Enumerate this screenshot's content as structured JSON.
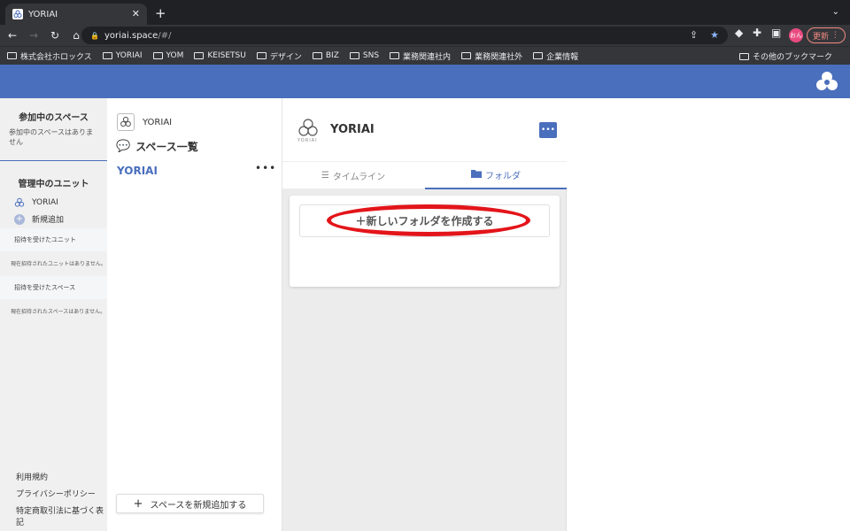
{
  "browser": {
    "tab_title": "YORIAI",
    "tab_close": "✕",
    "new_tab": "+",
    "url_host": "yoriai.space",
    "url_path": "/#/",
    "update_label": "更新",
    "profile_initials": "おん",
    "bookmarks": [
      "株式会社ホロックス",
      "YORIAI",
      "YOM",
      "KEISETSU",
      "デザイン",
      "BIZ",
      "SNS",
      "業務関連社内",
      "業務関連社外",
      "企業情報"
    ],
    "other_bookmarks": "その他のブックマーク"
  },
  "left_sidebar": {
    "joined_spaces_title": "参加中のスペース",
    "joined_spaces_empty": "参加中のスペースはありません",
    "managed_units_title": "管理中のユニット",
    "unit_name": "YORIAI",
    "add_new_label": "新規追加",
    "invited_units_label": "招待を受けたユニット",
    "invited_units_empty": "現在招待されたユニットはありません。",
    "invited_spaces_label": "招待を受けたスペース",
    "invited_spaces_empty": "現在招待されたスペースはありません。",
    "footer_links": [
      "利用規約",
      "プライバシーポリシー",
      "特定商取引法に基づく表記"
    ]
  },
  "middle_panel": {
    "unit_name": "YORIAI",
    "space_list_title": "スペース一覧",
    "space_name": "YORIAI",
    "more_label": "•••",
    "add_space_label": "スペースを新規追加する"
  },
  "content_panel": {
    "logo_sub": "YORIAI",
    "title": "YORIAI",
    "chat_label": "•••",
    "tabs": [
      {
        "label": "タイムライン",
        "icon": "list-icon",
        "active": false
      },
      {
        "label": "フォルダ",
        "icon": "folder-icon",
        "active": true
      }
    ],
    "new_folder_label": "＋新しいフォルダを作成する"
  },
  "colors": {
    "brand_blue": "#4a6fbd",
    "highlight_red": "#e3151a"
  }
}
